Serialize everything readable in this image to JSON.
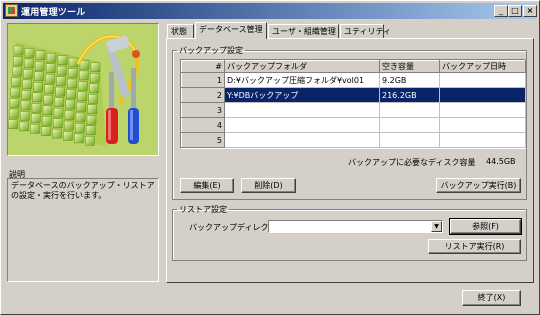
{
  "window": {
    "title": "運用管理ツール",
    "controls": {
      "minimize": "_",
      "maximize": "□",
      "close": "×"
    }
  },
  "tabs": [
    {
      "label": "状態",
      "active": false
    },
    {
      "label": "データベース管理",
      "active": true
    },
    {
      "label": "ユーザ・組織管理",
      "active": false
    },
    {
      "label": "ユティリティ",
      "active": false
    }
  ],
  "description": {
    "label": "説明",
    "text": "データベースのバックアップ・リストアの設定・実行を行います。"
  },
  "backup": {
    "group_label": "バックアップ設定",
    "columns": [
      "#",
      "バックアップフォルダ",
      "空き容量",
      "バックアップ日時"
    ],
    "rows": [
      {
        "num": "1",
        "folder": "D:¥バックアップ圧縮フォルダ¥vol01",
        "free": "9.2GB",
        "date": "",
        "selected": false
      },
      {
        "num": "2",
        "folder": "Y:¥DBバックアップ",
        "free": "216.2GB",
        "date": "",
        "selected": true
      },
      {
        "num": "3",
        "folder": "",
        "free": "",
        "date": "",
        "selected": false
      },
      {
        "num": "4",
        "folder": "",
        "free": "",
        "date": "",
        "selected": false
      },
      {
        "num": "5",
        "folder": "",
        "free": "",
        "date": "",
        "selected": false
      }
    ],
    "required_label": "バックアップに必要なディスク容量",
    "required_value": "44.5GB",
    "edit_button": "編集(E)",
    "delete_button": "削除(D)",
    "run_button": "バックアップ実行(B)"
  },
  "restore": {
    "group_label": "リストア設定",
    "dir_label": "バックアップディレクトリ",
    "dir_value": "",
    "browse_button": "参照(F)",
    "run_button": "リストア実行(R)"
  },
  "footer": {
    "exit_button": "終了(X)"
  },
  "icons": {
    "app": "app-icon",
    "illustration": "tools-grid-illustration"
  },
  "colors": {
    "selection": "#0a246a",
    "titlebar_start": "#0a246a",
    "titlebar_end": "#a6caf0",
    "illustration_bg": "#bcd46c"
  }
}
